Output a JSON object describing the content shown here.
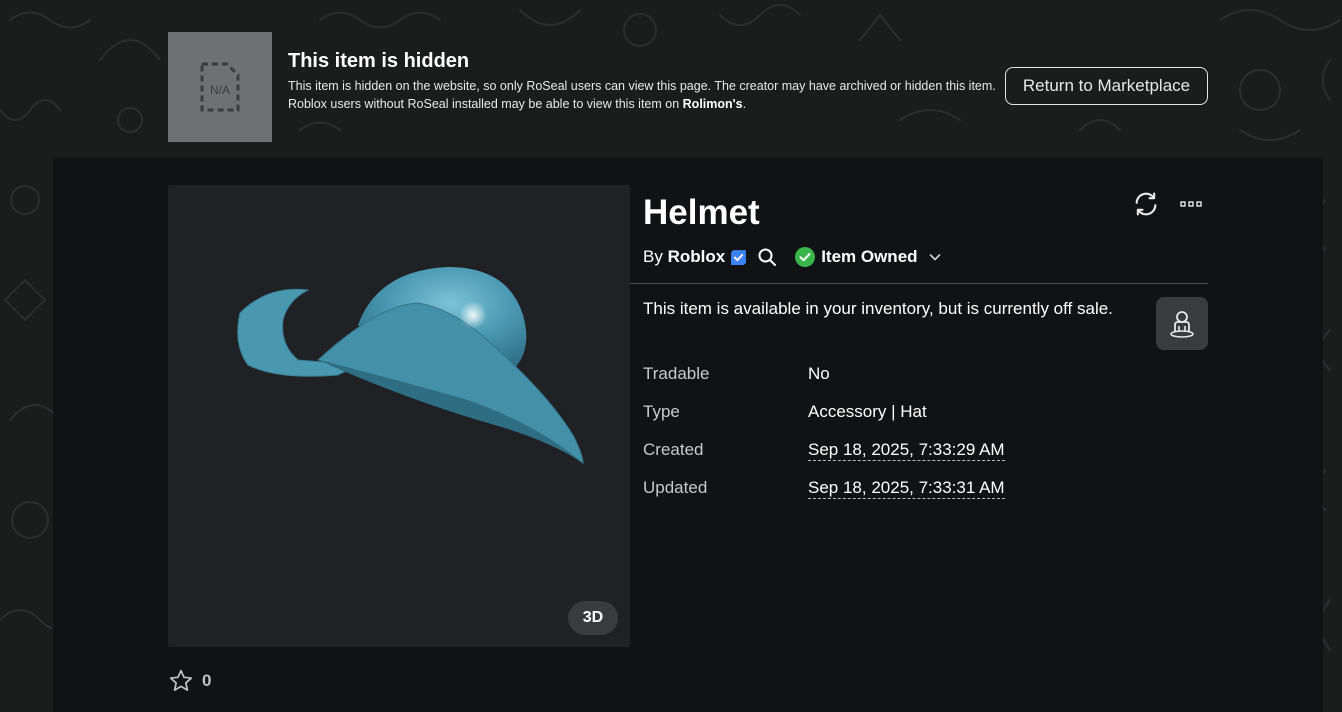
{
  "banner": {
    "thumb_text": "N/A",
    "title": "This item is hidden",
    "desc_line1": "This item is hidden on the website, so only RoSeal users can view this page. The creator may have archived or hidden this item.",
    "desc_line2_prefix": "Roblox users without RoSeal installed may be able to view this item on ",
    "desc_line2_link": "Rolimon's",
    "desc_line2_suffix": ".",
    "return_button": "Return to Marketplace"
  },
  "item": {
    "name": "Helmet",
    "by_label": "By",
    "creator": "Roblox",
    "owned_label": "Item Owned",
    "offsale_text": "This item is available in your inventory, but is currently off sale.",
    "viewer_badge": "3D",
    "favorites": "0",
    "accent_color": "#4aa0b9",
    "owned_color": "#39b54a",
    "verified_color": "#3b82f6"
  },
  "details": [
    {
      "label": "Tradable",
      "value": "No"
    },
    {
      "label": "Type",
      "value": "Accessory | Hat"
    },
    {
      "label": "Created",
      "value": "Sep 18, 2025, 7:33:29 AM"
    },
    {
      "label": "Updated",
      "value": "Sep 18, 2025, 7:33:31 AM"
    }
  ],
  "icons": [
    "na-file-icon",
    "verified-badge-icon",
    "search-icon",
    "check-circle-icon",
    "chevron-down-icon",
    "refresh-icon",
    "more-icon",
    "try-on-icon",
    "star-icon"
  ]
}
